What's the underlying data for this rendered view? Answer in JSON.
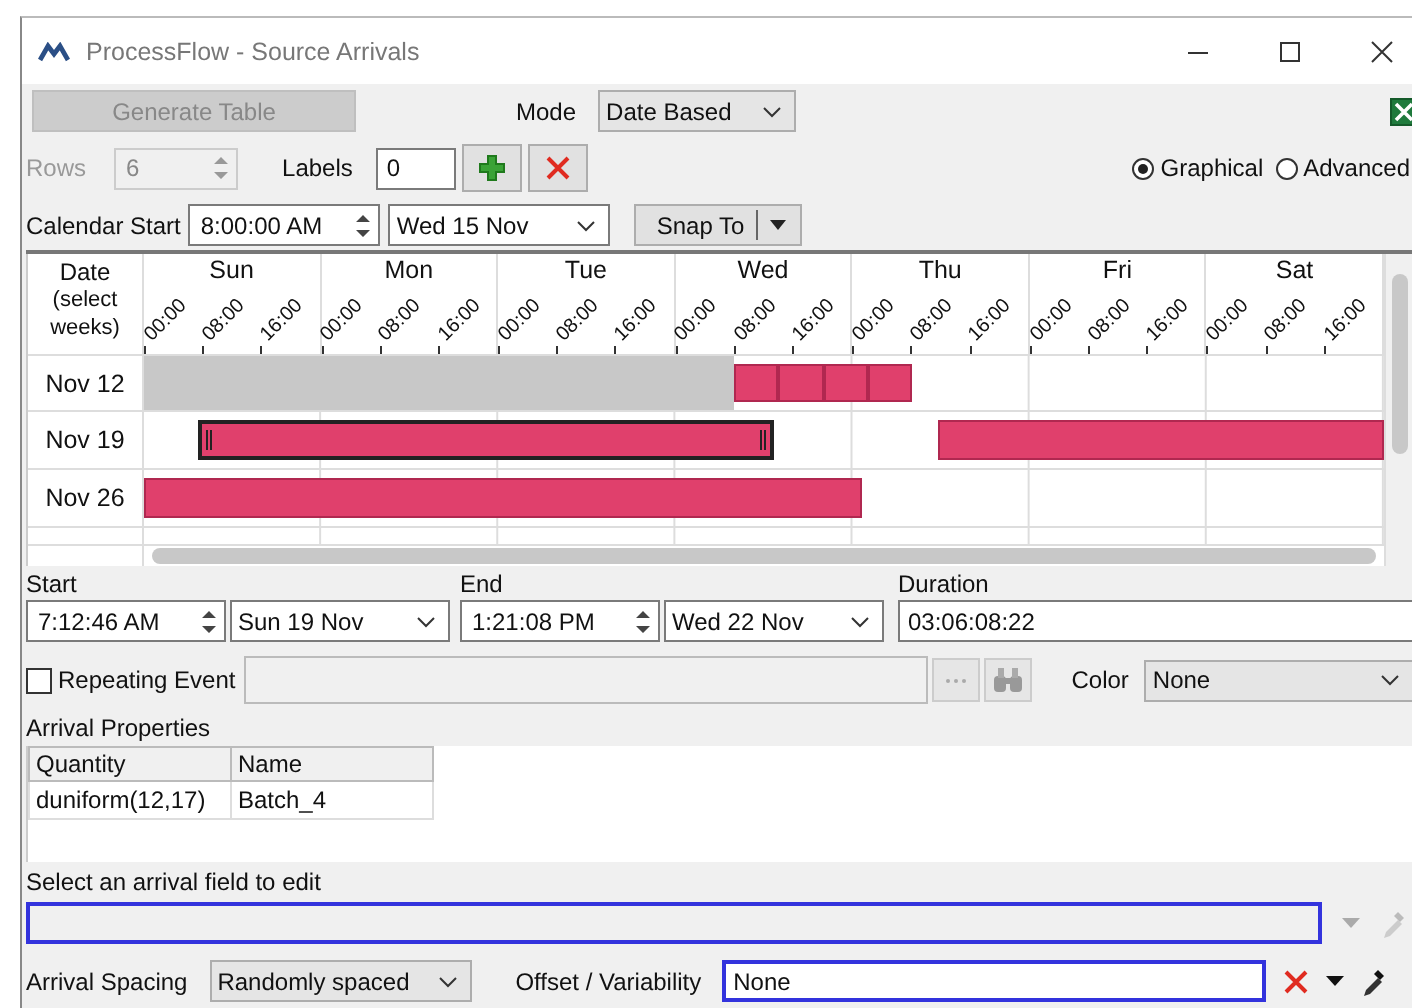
{
  "window": {
    "title": "ProcessFlow - Source Arrivals"
  },
  "toolbar": {
    "generate_button": {
      "label": "Generate Table",
      "disabled": true
    },
    "mode": {
      "label": "Mode",
      "value": "Date Based"
    },
    "rows": {
      "label": "Rows",
      "value": "6",
      "disabled": true
    },
    "labels": {
      "label": "Labels",
      "value": "0"
    },
    "view_options": [
      {
        "label": "Graphical",
        "selected": true
      },
      {
        "label": "Advanced",
        "selected": false
      }
    ],
    "calendar_start": {
      "label": "Calendar Start",
      "time": "8:00:00 AM",
      "date": "Wed 15 Nov"
    },
    "snap_button": {
      "label": "Snap To"
    }
  },
  "calendar": {
    "date_header": "Date",
    "date_subheader": "(select weeks)",
    "days": [
      {
        "label": "Sun",
        "ticks": [
          "00:00",
          "08:00",
          "16:00"
        ]
      },
      {
        "label": "Mon",
        "ticks": [
          "00:00",
          "08:00",
          "16:00"
        ]
      },
      {
        "label": "Tue",
        "ticks": [
          "00:00",
          "08:00",
          "16:00"
        ]
      },
      {
        "label": "Wed",
        "ticks": [
          "00:00",
          "08:00",
          "16:00"
        ]
      },
      {
        "label": "Thu",
        "ticks": [
          "00:00",
          "08:00",
          "16:00"
        ]
      },
      {
        "label": "Fri",
        "ticks": [
          "00:00",
          "08:00",
          "16:00"
        ]
      },
      {
        "label": "Sat",
        "ticks": [
          "00:00",
          "08:00",
          "16:00"
        ]
      }
    ],
    "weeks": [
      {
        "label": "Nov 12",
        "blocked": true,
        "events": [
          {
            "selected": false
          },
          {
            "selected": false
          },
          {
            "selected": false
          },
          {
            "selected": false
          }
        ]
      },
      {
        "label": "Nov 19",
        "blocked": false,
        "events": [
          {
            "selected": true
          },
          {
            "selected": false
          }
        ]
      },
      {
        "label": "Nov 26",
        "blocked": false,
        "events": [
          {
            "selected": false
          }
        ]
      }
    ]
  },
  "event_editor": {
    "start": {
      "label": "Start",
      "time": "7:12:46 AM",
      "date": "Sun  19 Nov"
    },
    "end": {
      "label": "End",
      "time": "1:21:08 PM",
      "date": "Wed 22 Nov"
    },
    "duration": {
      "label": "Duration",
      "value": "03:06:08:22"
    },
    "repeating": {
      "label": "Repeating Event",
      "checked": false
    },
    "color": {
      "label": "Color",
      "value": "None"
    }
  },
  "arrival_properties": {
    "title": "Arrival Properties",
    "columns": [
      "Quantity",
      "Name"
    ],
    "rows": [
      [
        "duniform(12,17)",
        "Batch_4"
      ]
    ]
  },
  "field_editor": {
    "label": "Select an arrival field to edit"
  },
  "spacing": {
    "label": "Arrival Spacing",
    "value": "Randomly spaced"
  },
  "offset": {
    "label": "Offset / Variability",
    "value": "None"
  }
}
